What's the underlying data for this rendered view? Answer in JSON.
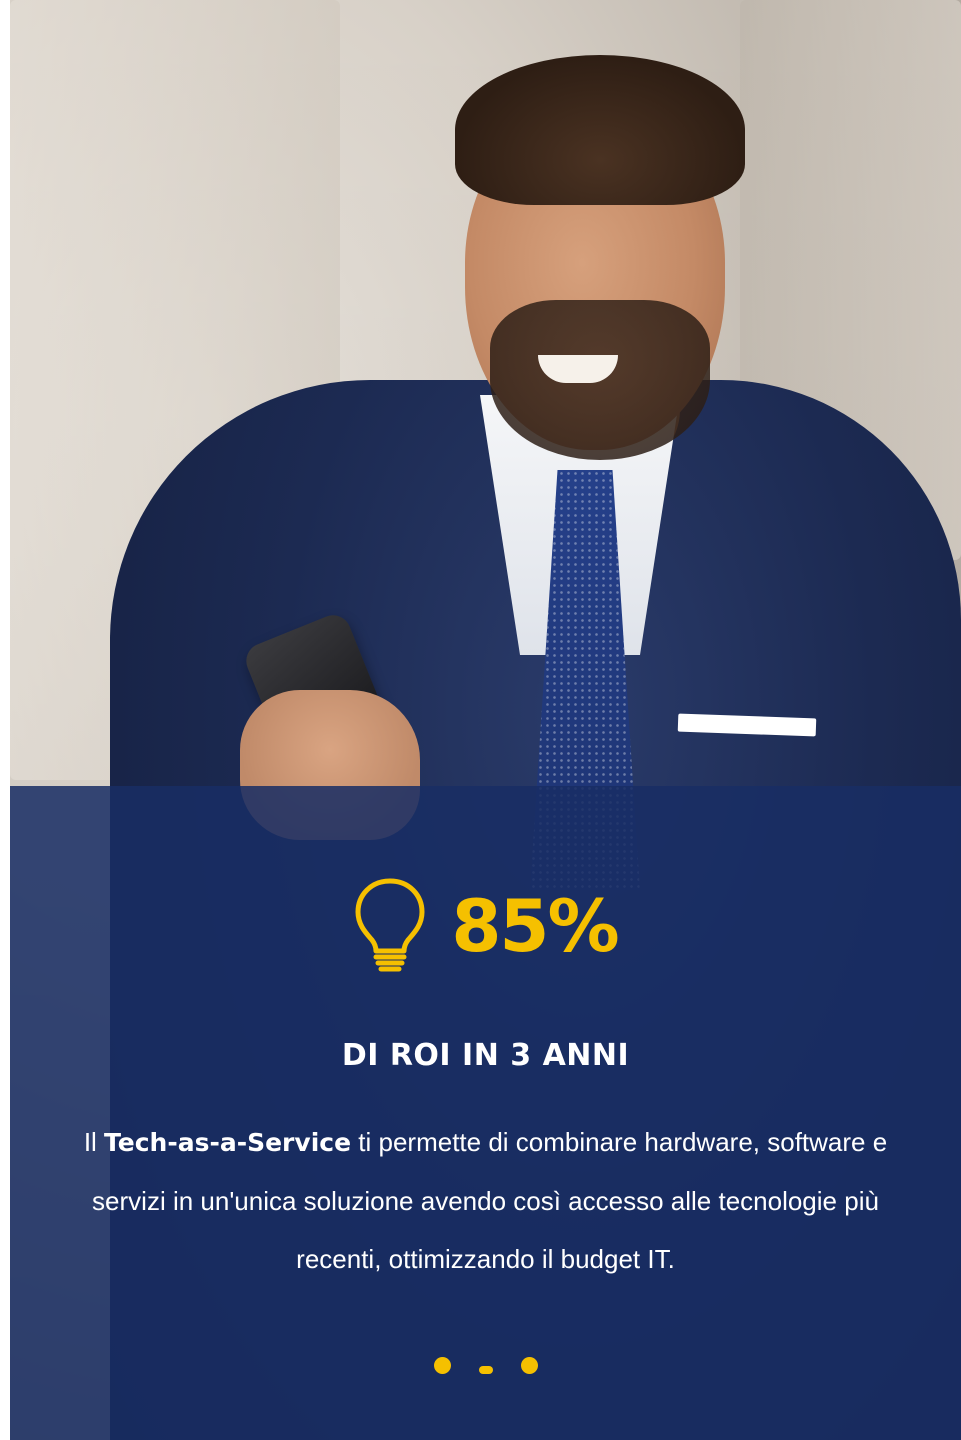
{
  "stat": {
    "value": "85%",
    "label": "DI ROI IN 3 ANNI",
    "icon": "lightbulb-icon"
  },
  "description": {
    "prefix": "Il ",
    "highlight": "Tech-as-a-Service",
    "suffix": " ti permette di combinare hardware, software e servizi in un'unica soluzione avendo così accesso alle tecnologie più recenti, ottimizzando il budget IT."
  },
  "carousel": {
    "slide_count": 3,
    "active_index": 1
  },
  "colors": {
    "accent": "#f5c000",
    "overlay": "#192d64",
    "text": "#ffffff"
  }
}
